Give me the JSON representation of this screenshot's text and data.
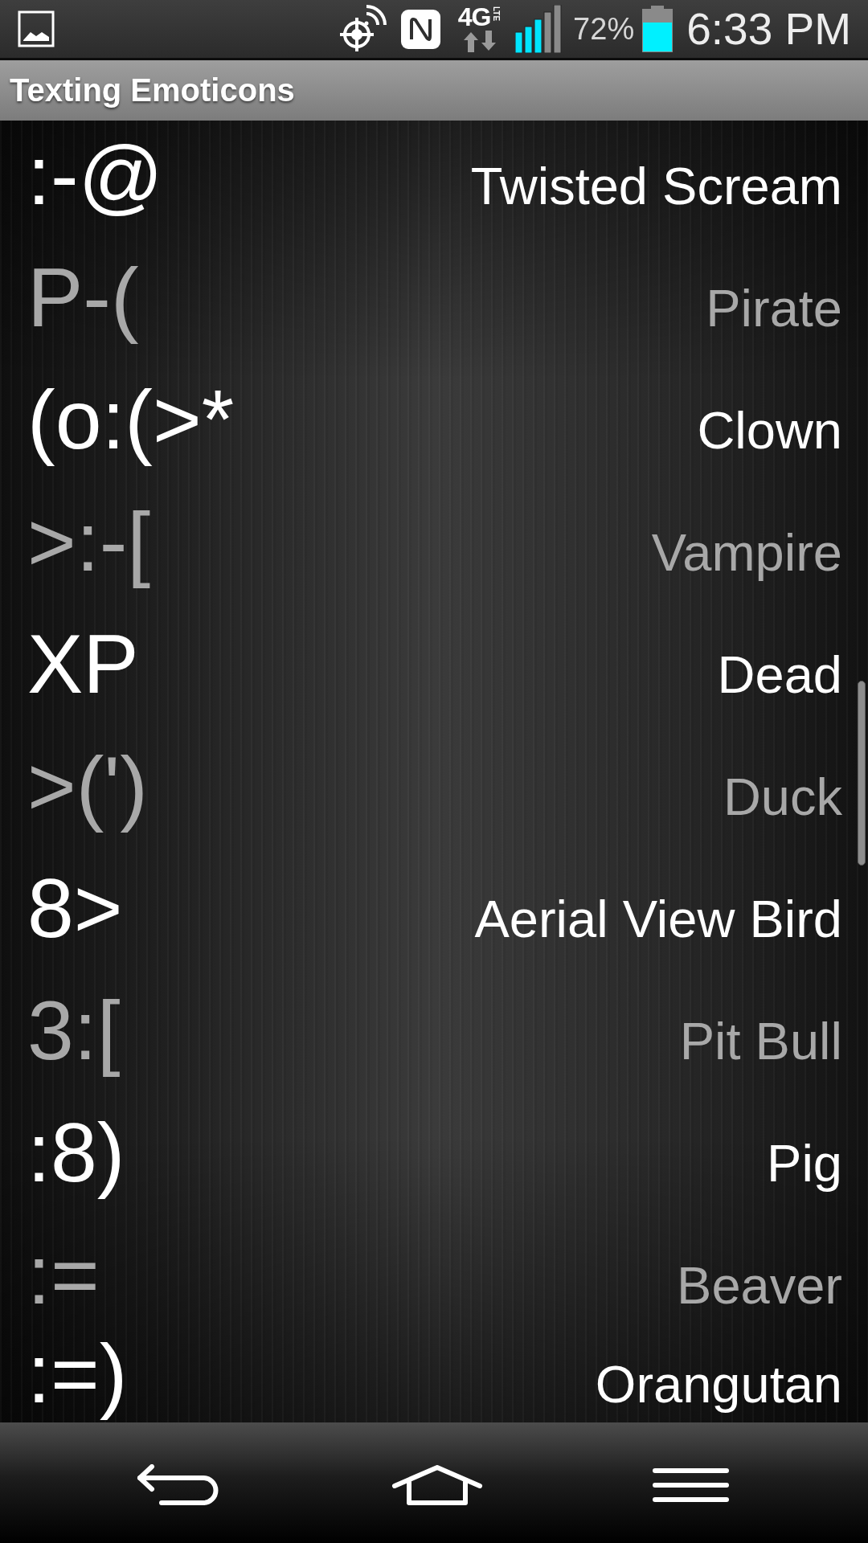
{
  "status_bar": {
    "network": {
      "label": "4G",
      "sublabel": "LTE"
    },
    "battery_percent": "72%",
    "time": "6:33 PM"
  },
  "title_bar": {
    "title": "Texting Emoticons"
  },
  "emoticons": [
    {
      "emoticon": ":-@",
      "name": "Twisted Scream"
    },
    {
      "emoticon": "P-(",
      "name": "Pirate"
    },
    {
      "emoticon": "(o:(>*",
      "name": "Clown"
    },
    {
      "emoticon": ">:-[",
      "name": "Vampire"
    },
    {
      "emoticon": "XP",
      "name": "Dead"
    },
    {
      "emoticon": ">(')",
      "name": "Duck"
    },
    {
      "emoticon": "8>",
      "name": "Aerial View Bird"
    },
    {
      "emoticon": "3:[",
      "name": "Pit Bull"
    },
    {
      "emoticon": ":8)",
      "name": "Pig"
    },
    {
      "emoticon": ":=",
      "name": "Beaver"
    },
    {
      "emoticon": ":=)",
      "name": "Orangutan"
    }
  ]
}
